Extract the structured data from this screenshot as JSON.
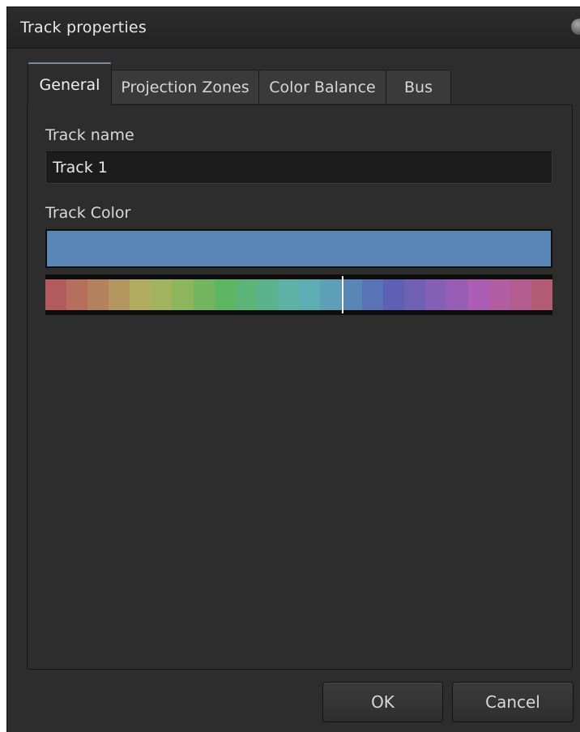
{
  "window": {
    "title": "Track properties"
  },
  "tabs": [
    {
      "label": "General",
      "active": true
    },
    {
      "label": "Projection Zones",
      "active": false
    },
    {
      "label": "Color Balance",
      "active": false
    },
    {
      "label": "Bus",
      "active": false
    }
  ],
  "general": {
    "track_name_label": "Track name",
    "track_name_value": "Track 1",
    "track_color_label": "Track Color",
    "track_color_hex": "#5a86b6",
    "palette": [
      "#b35a5c",
      "#b66f5c",
      "#b4825e",
      "#b3975f",
      "#b2ac5e",
      "#a3b25c",
      "#8db65c",
      "#73b55e",
      "#5fb662",
      "#5cb478",
      "#5bb28e",
      "#5cb2a4",
      "#5daeb4",
      "#5c9fb6",
      "#5a86b6",
      "#5a73b6",
      "#5e60b5",
      "#7060b5",
      "#845fb4",
      "#985eb5",
      "#ac5eb4",
      "#b25ea3",
      "#b45c8f",
      "#b45b76"
    ],
    "selected_palette_position": 0.585
  },
  "buttons": {
    "ok": "OK",
    "cancel": "Cancel"
  }
}
